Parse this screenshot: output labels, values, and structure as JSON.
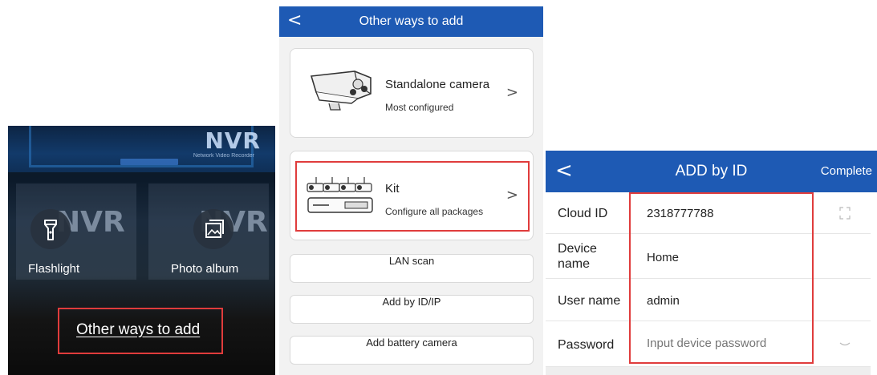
{
  "scanner": {
    "background_brand": "NVR",
    "background_brand_sub": "Network Video Recorder",
    "flashlight_label": "Flashlight",
    "photo_album_label": "Photo album",
    "other_ways_link": "Other ways to add",
    "icons": {
      "flashlight": "flashlight-icon",
      "photo_album": "photo-album-icon"
    }
  },
  "other_ways": {
    "header": {
      "back_glyph": "<",
      "title": "Other ways to add"
    },
    "cards": [
      {
        "title": "Standalone camera",
        "subtitle": "Most configured",
        "icon": "camera-icon",
        "chevron": ">"
      },
      {
        "title": "Kit",
        "subtitle": "Configure all packages",
        "icon": "kit-icon",
        "chevron": ">"
      }
    ],
    "buttons": [
      "LAN scan",
      "Add by ID/IP",
      "Add battery camera"
    ]
  },
  "add_by_id": {
    "header": {
      "back_glyph": "<",
      "title": "ADD by ID",
      "action": "Complete"
    },
    "fields": {
      "cloud_id": {
        "label": "Cloud ID",
        "value": "2318777788"
      },
      "device_name": {
        "label_line1": "Device",
        "label_line2": "name",
        "value": "Home"
      },
      "user_name": {
        "label": "User name",
        "value": "admin"
      },
      "password": {
        "label": "Password",
        "placeholder": "Input device password"
      }
    }
  },
  "colors": {
    "header_blue": "#1e5ab4",
    "highlight_red": "#e03c3c"
  }
}
